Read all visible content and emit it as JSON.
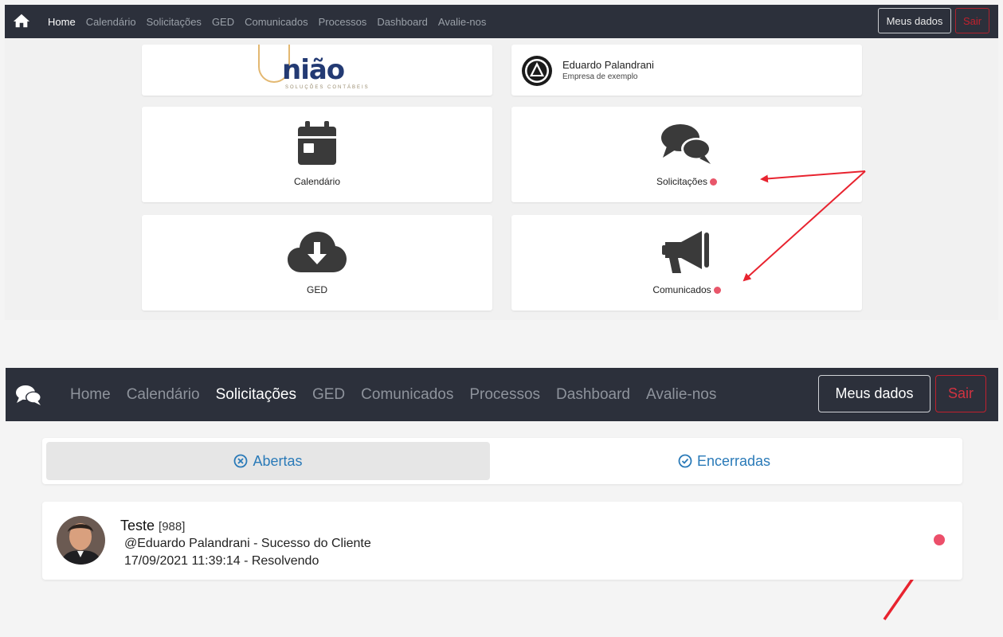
{
  "top": {
    "nav": {
      "home_icon": "home-icon",
      "links": [
        "Home",
        "Calendário",
        "Solicitações",
        "GED",
        "Comunicados",
        "Processos",
        "Dashboard",
        "Avalie-nos"
      ],
      "active": "Home",
      "meus_dados": "Meus dados",
      "sair": "Sair"
    },
    "logo": {
      "text": "nião",
      "sub": "SOLUÇÕES CONTÁBEIS"
    },
    "user": {
      "name": "Eduardo Palandrani",
      "company": "Empresa de exemplo"
    },
    "tiles": {
      "calendario": "Calendário",
      "solicitacoes": "Solicitações",
      "ged": "GED",
      "comunicados": "Comunicados"
    }
  },
  "bottom": {
    "nav": {
      "chat_icon": "chat-icon",
      "links": [
        "Home",
        "Calendário",
        "Solicitações",
        "GED",
        "Comunicados",
        "Processos",
        "Dashboard",
        "Avalie-nos"
      ],
      "active": "Solicitações",
      "meus_dados": "Meus dados",
      "sair": "Sair"
    },
    "tabs": {
      "abertas": "Abertas",
      "encerradas": "Encerradas"
    },
    "ticket": {
      "title": "Teste",
      "number": "[988]",
      "author": "@Eduardo Palandrani - Sucesso do Cliente",
      "date_status": "17/09/2021 11:39:14 - Resolvendo"
    }
  },
  "colors": {
    "navbar": "#2c303b",
    "accent_blue": "#2a7ab8",
    "sair_red": "#c2212d",
    "badge_pink": "#e8566a",
    "annotation_red": "#e8232f"
  }
}
